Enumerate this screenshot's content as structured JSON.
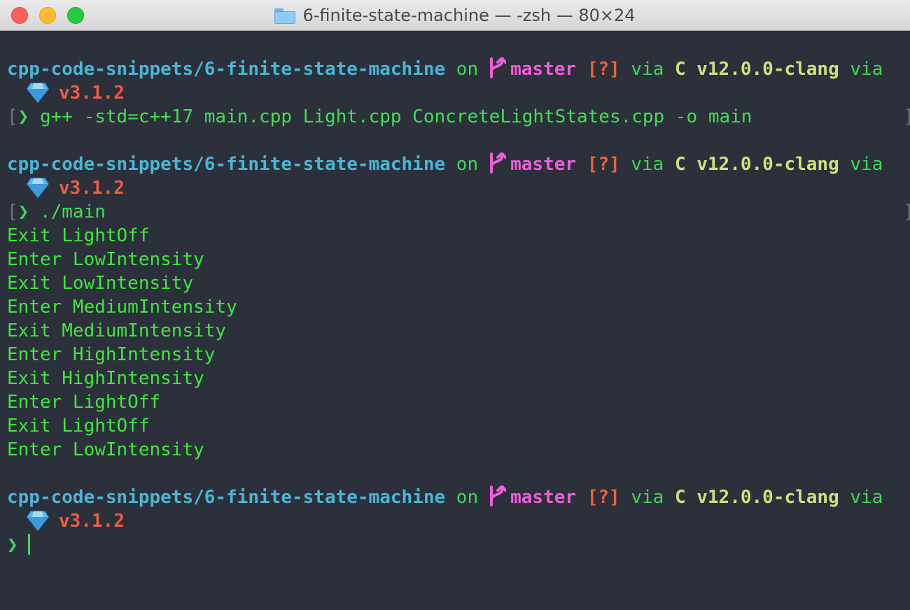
{
  "window": {
    "title": "6-finite-state-machine — -zsh — 80×24"
  },
  "prompt_info": {
    "path": "cpp-code-snippets/6-finite-state-machine",
    "on": "on",
    "branch": "master",
    "status": "[?]",
    "via": "via",
    "lang_name": "C",
    "lang_version": "v12.0.0-clang",
    "via2": "via",
    "ruby_version": "v3.1.2",
    "prompt_char": "❯",
    "left_bracket": "[",
    "right_bracket": "]"
  },
  "commands": [
    "g++ -std=c++17 main.cpp Light.cpp ConcreteLightStates.cpp -o main",
    "./main"
  ],
  "output": [
    "Exit LightOff",
    "Enter LowIntensity",
    "Exit LowIntensity",
    "Enter MediumIntensity",
    "Exit MediumIntensity",
    "Enter HighIntensity",
    "Exit HighIntensity",
    "Enter LightOff",
    "Exit LightOff",
    "Enter LowIntensity"
  ],
  "icons": {
    "folder": "folder-icon",
    "branch": "git-branch-icon",
    "gem": "ruby-gem-icon"
  },
  "colors": {
    "background": "#2b303b",
    "path": "#49b6d6",
    "branch": "#f15edb",
    "status": "#f0603a",
    "lang": "#cde17a",
    "ruby": "#ef5a44",
    "output": "#3fe63e"
  }
}
